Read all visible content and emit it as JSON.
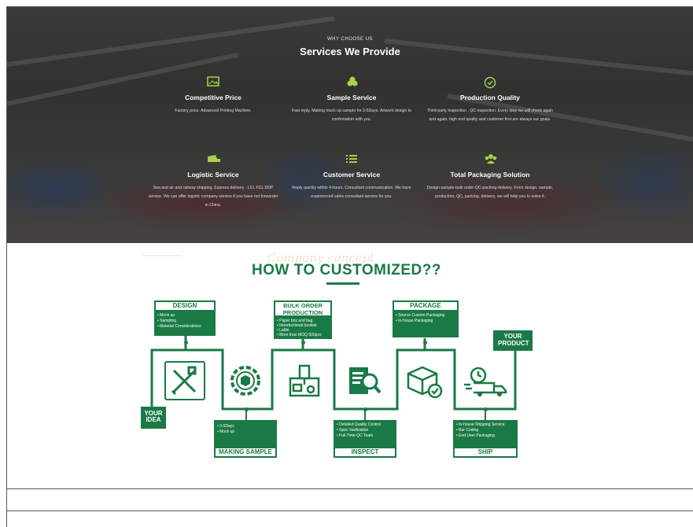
{
  "hero": {
    "eyebrow": "WHY CHOOSE US",
    "title": "Services We Provide",
    "services": [
      {
        "icon": "image-icon",
        "title": "Competitive Price",
        "desc": "Factory price. Advanced Printing Machine."
      },
      {
        "icon": "cluster-icon",
        "title": "Sample Service",
        "desc": "Fast reply. Making mock up sample for 3-5Days. Artwork design to confirmation with you."
      },
      {
        "icon": "check-circle-icon",
        "title": "Production Quality",
        "desc": "Third-party Inspection . QC inspection. Every step we will check again and again, high end quality and customer first are always our goals."
      },
      {
        "icon": "truck-icon",
        "title": "Logistic Service",
        "desc": "Sea and air and railway shipping. Express delivery . LCL FCL DDP service. We can offer logistic company service if you have not forwarder in China."
      },
      {
        "icon": "list-icon",
        "title": "Customer Service",
        "desc": "Reply quickly within 4 hours. Consultant communication. We have experienced sales consultant service for you."
      },
      {
        "icon": "people-icon",
        "title": "Total Packaging Solution",
        "desc": "Design-sample-bulk order-QC-packing-delivery. From design, sample, production, QC, packing, delivery, we will help you to solve it."
      }
    ]
  },
  "process": {
    "title": "HOW TO CUSTOMIZED??",
    "start": "YOUR IDEA",
    "end": "YOUR PRODUCT",
    "top_steps": [
      {
        "title": "DESIGN",
        "items": [
          "Mock up",
          "Sampling",
          "Material Considerations"
        ]
      },
      {
        "title": "BULK ORDER PRODUCTION",
        "items": [
          "Paper box and bag",
          "Introductional booklet",
          "Lable",
          "More than MOQ 500pcs"
        ]
      },
      {
        "title": "PACKAGE",
        "items": [
          "Source Custom Packaging",
          "In-house Packaging"
        ]
      }
    ],
    "bottom_steps": [
      {
        "title": "MAKING SAMPLE",
        "items": [
          "3-5Days",
          "Mock up"
        ]
      },
      {
        "title": "INSPECT",
        "items": [
          "Detailed Quality Control",
          "Spec Varification",
          "Full-Time QC Team"
        ]
      },
      {
        "title": "SHIP",
        "items": [
          "In-house Shipping Service",
          "Bar Coding",
          "End User Packaging"
        ]
      }
    ],
    "icons": [
      "pencil-ruler-icon",
      "gear-box-icon",
      "printing-machine-icon",
      "inspect-search-icon",
      "package-check-icon",
      "delivery-truck-icon"
    ]
  }
}
